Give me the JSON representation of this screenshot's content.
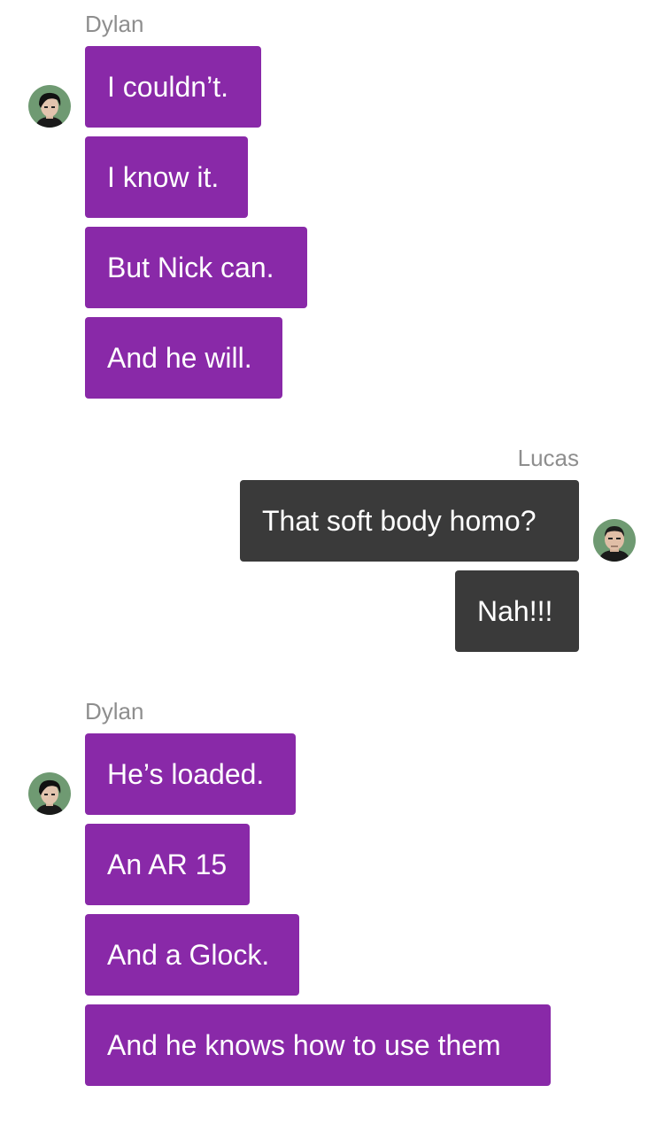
{
  "groups": [
    {
      "sender": "Dylan",
      "messages": [
        "I couldn’t.",
        "I know it.",
        "But Nick can.",
        "And he will."
      ]
    },
    {
      "sender": "Lucas",
      "messages": [
        "That soft body homo?",
        "Nah!!!"
      ]
    },
    {
      "sender": "Dylan",
      "messages": [
        "He’s loaded.",
        "An AR 15",
        "And a Glock.",
        "And he knows how to use them"
      ]
    }
  ],
  "colors": {
    "incoming_bubble": "#8929a8",
    "outgoing_bubble": "#3a3a3a",
    "sender_name": "#8e8e8e",
    "bubble_text": "#ffffff"
  }
}
